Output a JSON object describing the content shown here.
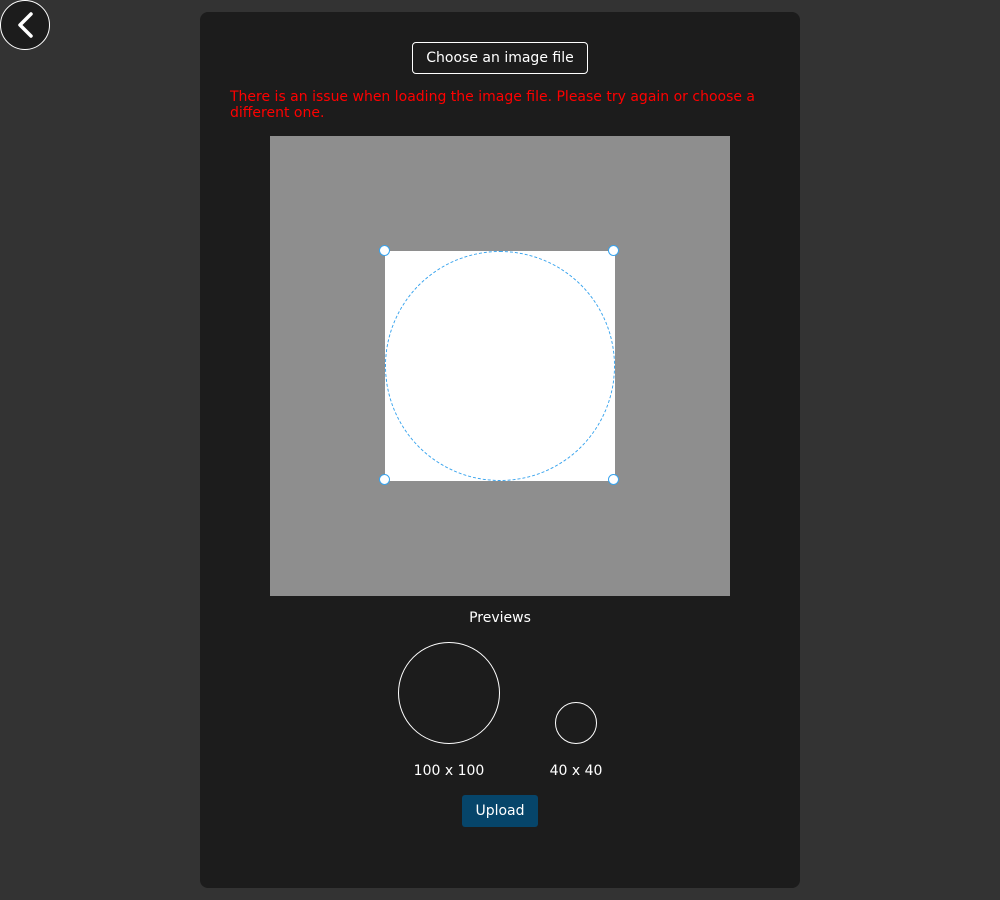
{
  "navigation": {
    "back_icon": "chevron-left-icon"
  },
  "uploader": {
    "choose_label": "Choose an image file",
    "error_message": "There is an issue when loading the image file. Please try again or choose a different one.",
    "error_color": "#ff0000",
    "crop_outline_color": "#39a4ee"
  },
  "previews": {
    "title": "Previews",
    "large_label": "100 x 100",
    "small_label": "40 x 40"
  },
  "actions": {
    "upload_label": "Upload",
    "upload_color": "#06456a"
  }
}
